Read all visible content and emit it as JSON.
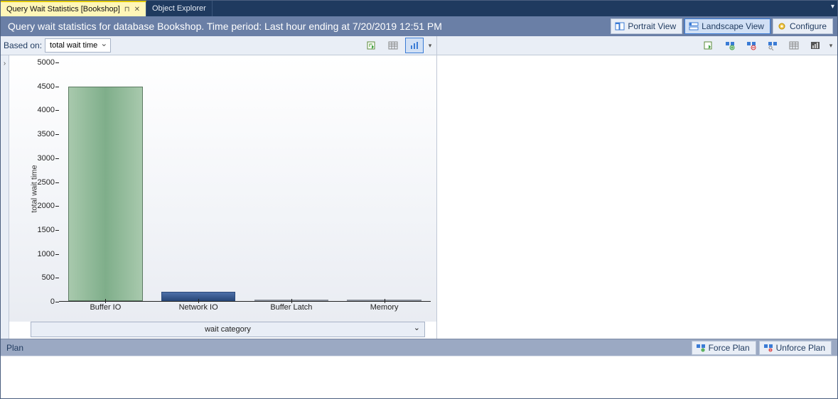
{
  "tabs": {
    "active": "Query Wait Statistics [Bookshop]",
    "other": "Object Explorer"
  },
  "titlebar": {
    "text": "Query wait statistics for database Bookshop. Time period: Last hour ending at 7/20/2019 12:51 PM",
    "portrait": "Portrait View",
    "landscape": "Landscape View",
    "configure": "Configure"
  },
  "toolbar_left": {
    "based_on_label": "Based on:",
    "based_on_value": "total wait time"
  },
  "chart_data": {
    "type": "bar",
    "ylabel": "total wait time",
    "xlabel": "wait category",
    "ylim": [
      0,
      5000
    ],
    "yticks": [
      0,
      500,
      1000,
      1500,
      2000,
      2500,
      3000,
      3500,
      4000,
      4500,
      5000
    ],
    "categories": [
      "Buffer IO",
      "Network IO",
      "Buffer Latch",
      "Memory"
    ],
    "values": [
      4500,
      200,
      25,
      15
    ],
    "colors": [
      "green",
      "blue",
      "gray",
      "gray"
    ]
  },
  "plan_bar": {
    "title": "Plan",
    "force": "Force Plan",
    "unforce": "Unforce Plan"
  }
}
